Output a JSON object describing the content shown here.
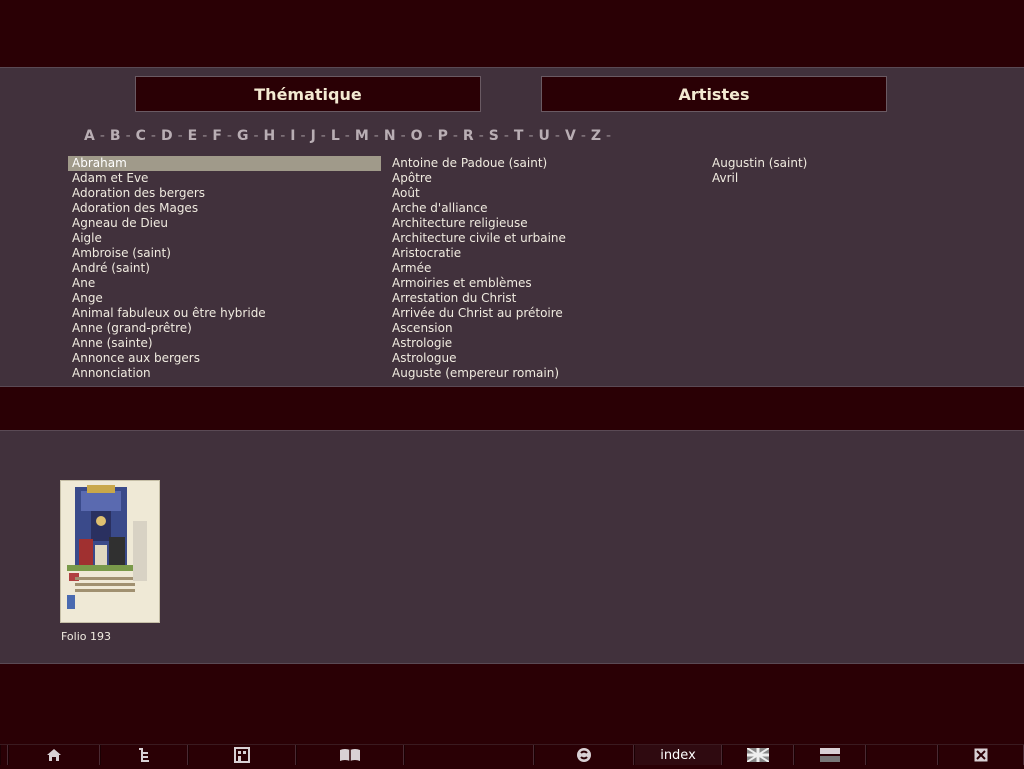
{
  "tabs": {
    "thematique": "Thématique",
    "artistes": "Artistes"
  },
  "alphabet": [
    "A",
    "B",
    "C",
    "D",
    "E",
    "F",
    "G",
    "H",
    "I",
    "J",
    "L",
    "M",
    "N",
    "O",
    "P",
    "R",
    "S",
    "T",
    "U",
    "V",
    "Z"
  ],
  "alphabet_separator": "-",
  "columns": [
    [
      "Abraham",
      "Adam et Eve",
      "Adoration des bergers",
      "Adoration des Mages",
      "Agneau de Dieu",
      "Aigle",
      "Ambroise (saint)",
      "André (saint)",
      "Ane",
      "Ange",
      "Animal fabuleux ou être hybride",
      "Anne (grand-prêtre)",
      "Anne (sainte)",
      "Annonce aux bergers",
      "Annonciation"
    ],
    [
      "Antoine de Padoue (saint)",
      "Apôtre",
      "Août",
      "Arche d'alliance",
      "Architecture religieuse",
      "Architecture civile et urbaine",
      "Aristocratie",
      "Armée",
      "Armoiries et emblèmes",
      "Arrestation du Christ",
      "Arrivée du Christ au prétoire",
      "Ascension",
      "Astrologie",
      "Astrologue",
      "Auguste (empereur romain)"
    ],
    [
      "Augustin (saint)",
      "Avril"
    ]
  ],
  "selected_item": "Abraham",
  "results": {
    "thumbnail_label": "Folio 193"
  },
  "bottom_bar": {
    "index_label": "index",
    "icons": [
      "home-icon",
      "tree-icon",
      "building-icon",
      "book-icon",
      "refresh-icon",
      "index",
      "union-jack-icon",
      "stripes-icon",
      "close-icon"
    ]
  },
  "colors": {
    "background": "#2a0005",
    "panel": "#41313c",
    "selected": "#a09a8a",
    "text": "#f0ebe0"
  }
}
